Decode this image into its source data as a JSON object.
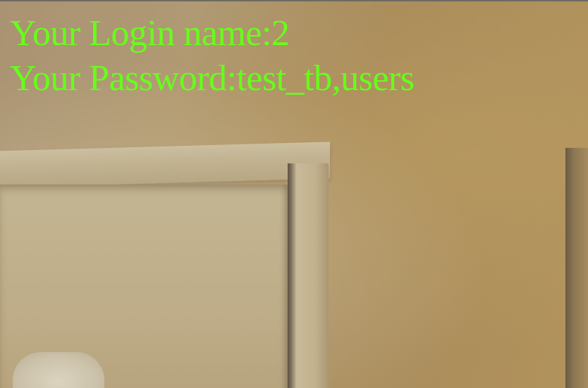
{
  "overlay": {
    "login_line": "Your Login name:2",
    "password_line": "Your Password:test_tb,users",
    "text_color": "#66ff1a"
  },
  "background": {
    "wall_color": "#a88c60",
    "door_color": "#c4b592"
  }
}
